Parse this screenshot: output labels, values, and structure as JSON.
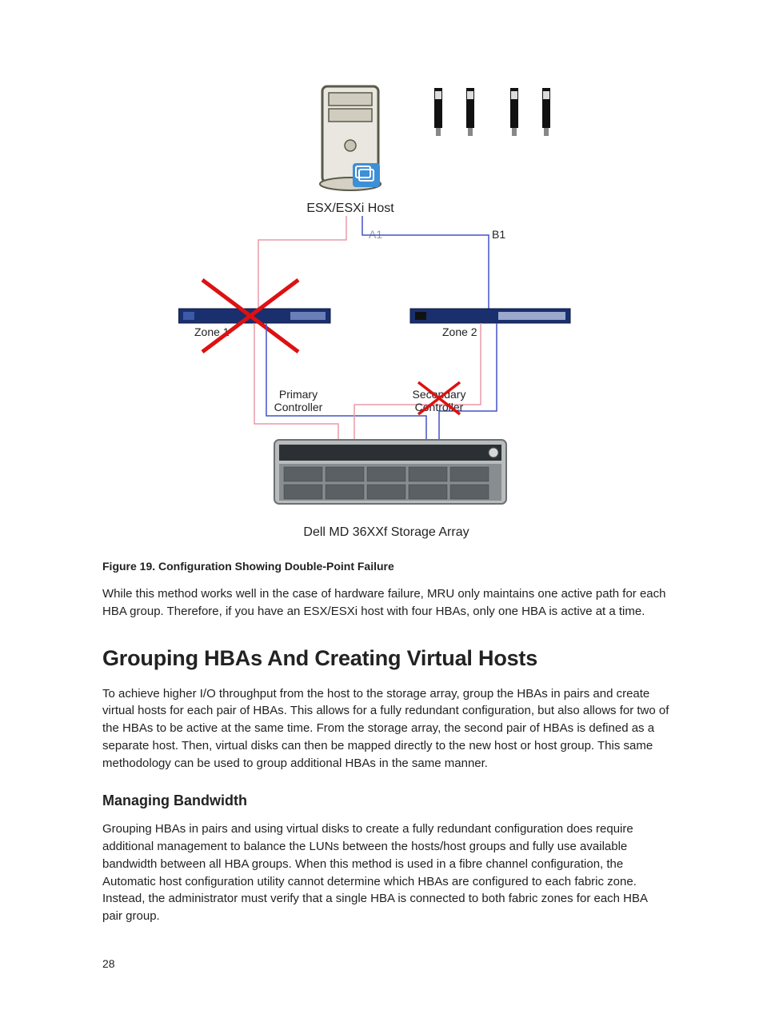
{
  "figure": {
    "host_label": "ESX/ESXi Host",
    "path_a": "A1",
    "path_b": "B1",
    "zone1": "Zone 1",
    "zone2": "Zone 2",
    "primary_controller_l1": "Primary",
    "primary_controller_l2": "Controller",
    "secondary_controller_l1": "Secondary",
    "secondary_controller_l2": "Controller",
    "array_label": "Dell MD 36XXf Storage Array",
    "caption": "Figure 19. Configuration Showing Double-Point Failure"
  },
  "paragraph1": "While this method works well in the case of hardware failure, MRU only maintains one active path for each HBA group. Therefore, if you have an ESX/ESXi host with four HBAs, only one HBA is active at a time.",
  "heading1": "Grouping HBAs And Creating Virtual Hosts",
  "paragraph2": "To achieve higher I/O throughput from the host to the storage array, group the HBAs in pairs and create virtual hosts for each pair of HBAs. This allows for a fully redundant configuration, but also allows for two of the HBAs to be active at the same time. From the storage array, the second pair of HBAs is defined as a separate host. Then, virtual disks can then be mapped directly to the new host or host group. This same methodology can be used to group additional HBAs in the same manner.",
  "subheading1": "Managing Bandwidth",
  "paragraph3": "Grouping HBAs in pairs and using virtual disks to create a fully redundant configuration does require additional management to balance the LUNs between the hosts/host groups and fully use available bandwidth between all HBA groups. When this method is used in a fibre channel configuration, the Automatic host configuration utility cannot determine which HBAs are configured to each fabric zone. Instead, the administrator must verify that a single HBA is connected to both fabric zones for each HBA pair group.",
  "page_number": "28"
}
